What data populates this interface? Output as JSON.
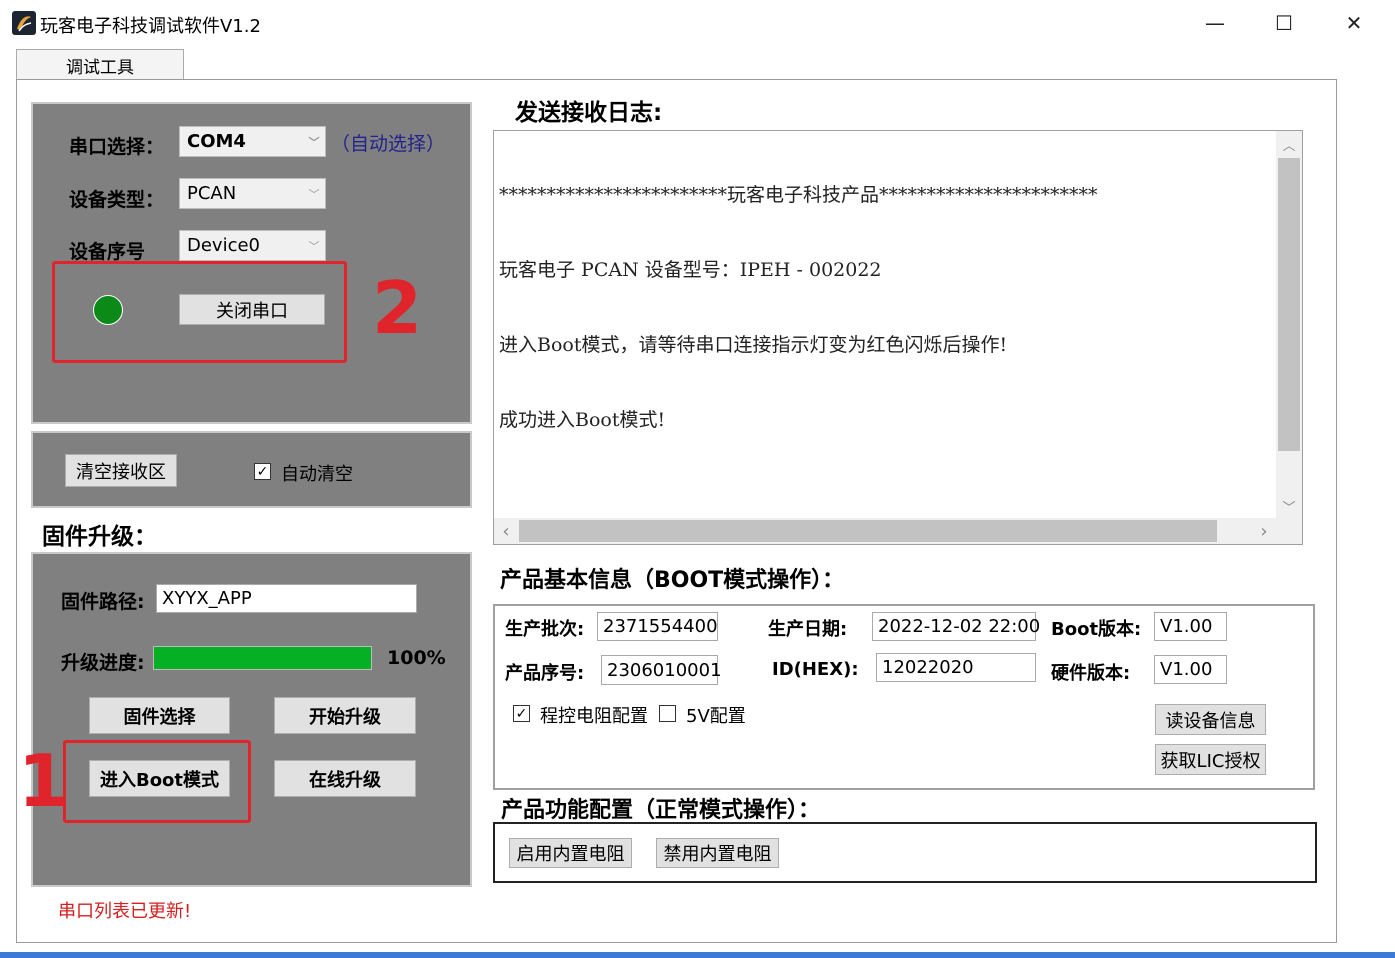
{
  "window": {
    "title": "玩客电子科技调试软件V1.2",
    "controls": {
      "minimize": "—",
      "maximize": "☐",
      "close": "✕"
    }
  },
  "tabs": [
    {
      "label": "调试工具",
      "active": true
    }
  ],
  "serial": {
    "port_label": "串口选择：",
    "port_value": "COM4",
    "auto_select": "（自动选择）",
    "device_type_label": "设备类型：",
    "device_type_value": "PCAN",
    "device_index_label": "设备序号",
    "device_index_value": "Device0",
    "status_led_color": "#0b8a18",
    "close_port_button": "关闭串口",
    "annotation_2": "2"
  },
  "receive": {
    "clear_button": "清空接收区",
    "auto_clear_label": "自动清空",
    "auto_clear_checked": true
  },
  "firmware": {
    "section_title": "固件升级：",
    "path_label": "固件路径:",
    "path_value": "XYYX_APP",
    "progress_label": "升级进度:",
    "progress_percent": 100,
    "progress_text": "100%",
    "select_button": "固件选择",
    "start_button": "开始升级",
    "boot_button": "进入Boot模式",
    "online_button": "在线升级",
    "annotation_1": "1",
    "status_message": "串口列表已更新!"
  },
  "log": {
    "title": "发送接收日志:",
    "lines": [
      "************************玩客电子科技产品***********************",
      "玩客电子 PCAN 设备型号：IPEH - 002022",
      "进入Boot模式，请等待串口连接指示灯变为红色闪烁后操作!",
      "成功进入Boot模式!"
    ],
    "scroll_up": "︿",
    "scroll_down": "﹀",
    "scroll_left": "‹",
    "scroll_right": "›"
  },
  "product_info": {
    "title": "产品基本信息（BOOT模式操作）：",
    "batch_label": "生产批次:",
    "batch_value": "2371554400",
    "date_label": "生产日期:",
    "date_value": "2022-12-02 22:00",
    "boot_version_label": "Boot版本:",
    "boot_version_value": "V1.00",
    "serial_label": "产品序号:",
    "serial_value": "2306010001",
    "id_label": "ID(HEX):",
    "id_value": "12022020",
    "hw_version_label": "硬件版本:",
    "hw_version_value": "V1.00",
    "resistor_config_label": "程控电阻配置",
    "resistor_config_checked": true,
    "five_v_label": "5V配置",
    "five_v_checked": false,
    "read_button": "读设备信息",
    "lic_button": "获取LIC授权"
  },
  "product_func": {
    "title": "产品功能配置（正常模式操作）：",
    "enable_button": "启用内置电阻",
    "disable_button": "禁用内置电阻"
  },
  "colors": {
    "panel_gray": "#808080",
    "annotation_red": "#e0242b",
    "progress_green": "#06b025",
    "status_red": "#d42020",
    "accent_blue": "#23238e"
  }
}
